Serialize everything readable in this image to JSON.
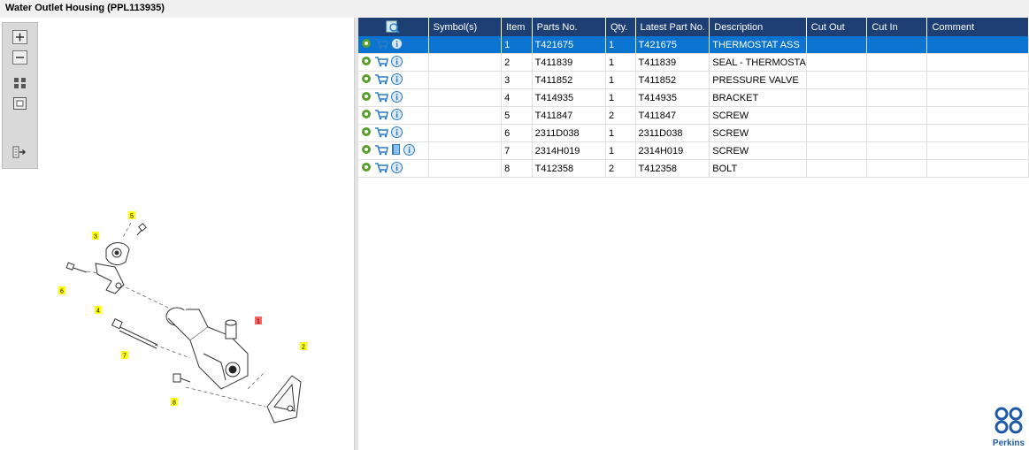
{
  "window": {
    "title": "Water Outlet Housing (PPL113935)"
  },
  "toolbar": {
    "items": [
      {
        "icon": "zoom-in-icon"
      },
      {
        "icon": "zoom-out-icon"
      },
      {
        "icon": "fit-grid-icon"
      },
      {
        "icon": "actual-size-icon"
      },
      {
        "icon": "export-icon"
      }
    ]
  },
  "diagram": {
    "callouts": [
      "1",
      "2",
      "3",
      "4",
      "5",
      "6",
      "7",
      "8"
    ],
    "highlight_color": "#ffff00",
    "selected_color": "#ff6060"
  },
  "table": {
    "columns": [
      "",
      "Symbol(s)",
      "Item",
      "Parts No.",
      "Qty.",
      "Latest Part No.",
      "Description",
      "Cut Out",
      "Cut In",
      "Comment"
    ],
    "header_color": "#1e3f74",
    "selected_color": "#0a74d0",
    "rows": [
      {
        "item": "1",
        "part_no": "T421675",
        "qty": "1",
        "latest": "T421675",
        "desc": "THERMOSTAT ASS",
        "cut_out": "",
        "cut_in": "",
        "comment": "",
        "selected": true
      },
      {
        "item": "2",
        "part_no": "T411839",
        "qty": "1",
        "latest": "T411839",
        "desc": "SEAL - THERMOSTA",
        "cut_out": "",
        "cut_in": "",
        "comment": ""
      },
      {
        "item": "3",
        "part_no": "T411852",
        "qty": "1",
        "latest": "T411852",
        "desc": "PRESSURE VALVE",
        "cut_out": "",
        "cut_in": "",
        "comment": ""
      },
      {
        "item": "4",
        "part_no": "T414935",
        "qty": "1",
        "latest": "T414935",
        "desc": "BRACKET",
        "cut_out": "",
        "cut_in": "",
        "comment": ""
      },
      {
        "item": "5",
        "part_no": "T411847",
        "qty": "2",
        "latest": "T411847",
        "desc": "SCREW",
        "cut_out": "",
        "cut_in": "",
        "comment": ""
      },
      {
        "item": "6",
        "part_no": "2311D038",
        "qty": "1",
        "latest": "2311D038",
        "desc": "SCREW",
        "cut_out": "",
        "cut_in": "",
        "comment": ""
      },
      {
        "item": "7",
        "part_no": "2314H019",
        "qty": "1",
        "latest": "2314H019",
        "desc": "SCREW",
        "cut_out": "",
        "cut_in": "",
        "comment": "",
        "has_book": true
      },
      {
        "item": "8",
        "part_no": "T412358",
        "qty": "2",
        "latest": "T412358",
        "desc": "BOLT",
        "cut_out": "",
        "cut_in": "",
        "comment": ""
      }
    ]
  },
  "logo": {
    "text": "Perkins",
    "color": "#1e5aa8"
  }
}
